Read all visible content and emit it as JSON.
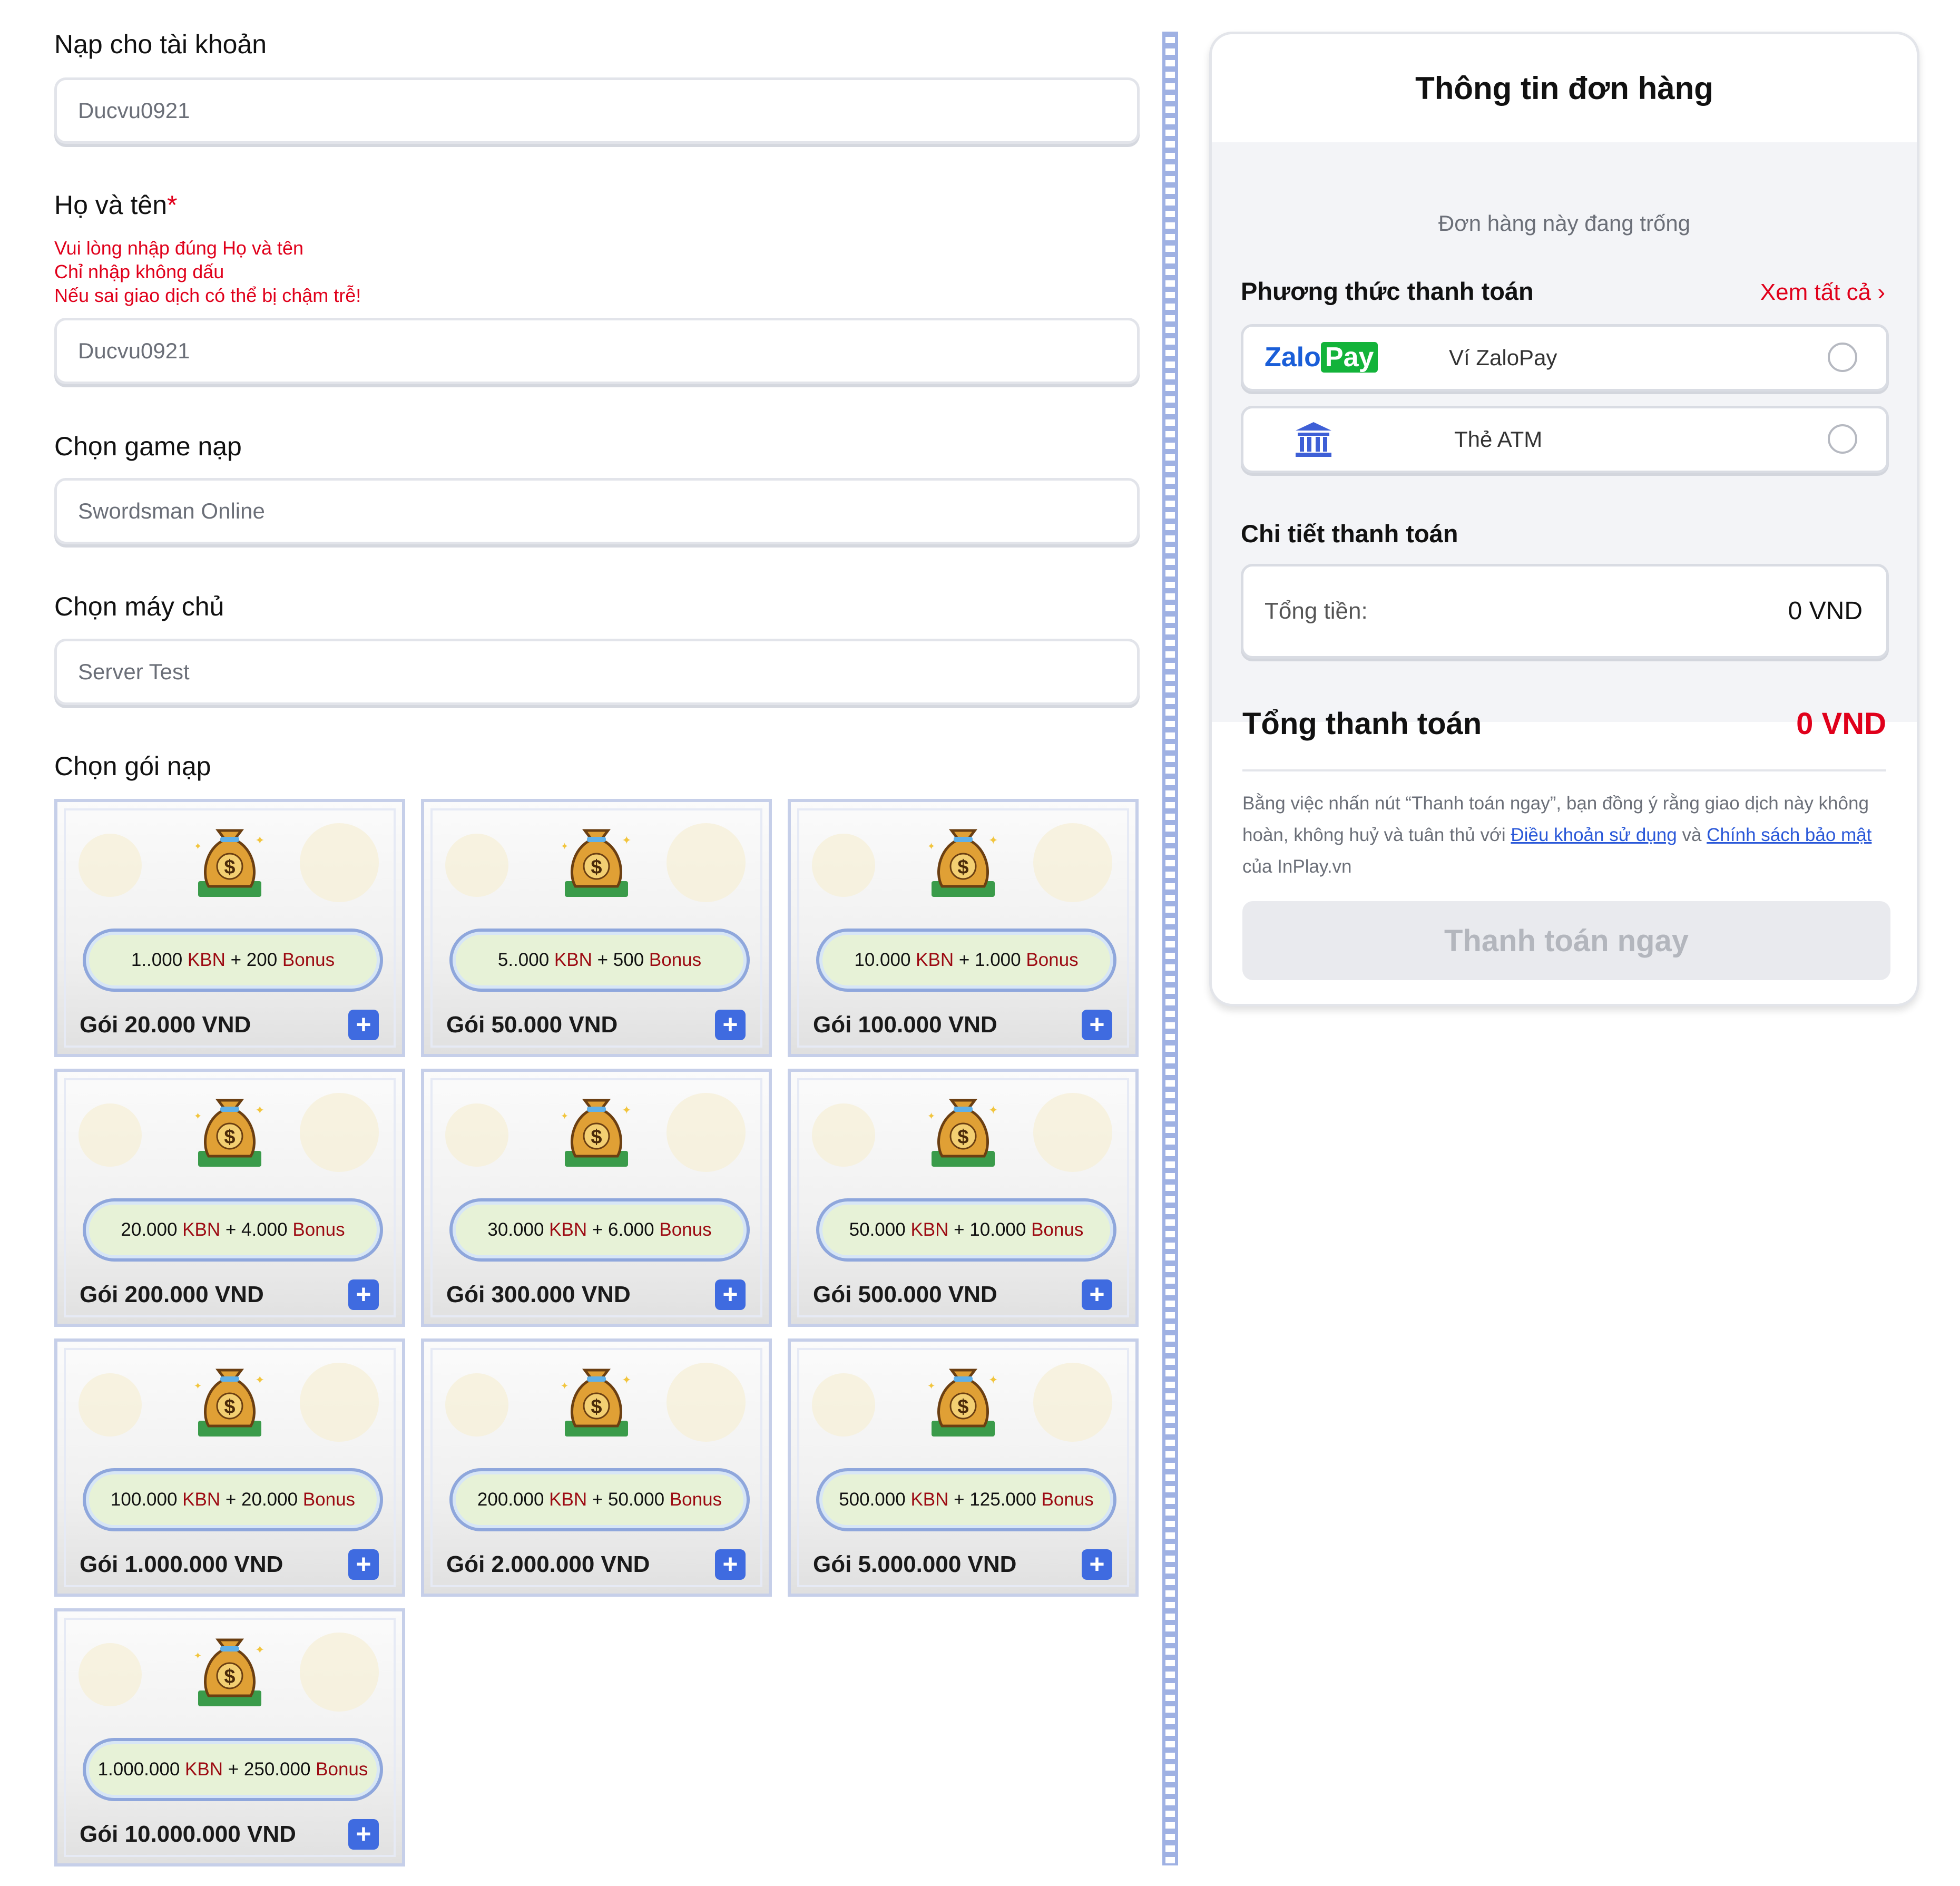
{
  "form": {
    "account_label": "Nạp cho tài khoản",
    "account_value": "Ducvu0921",
    "name_label": "Họ và tên",
    "name_required": "*",
    "name_warnings": [
      "Vui lòng nhập đúng Họ và tên",
      "Chỉ nhập không dấu",
      "Nếu sai giao dịch có thể bị chậm trễ!"
    ],
    "name_value": "Ducvu0921",
    "game_label": "Chọn game nạp",
    "game_value": "Swordsman Online",
    "server_label": "Chọn máy chủ",
    "server_value": "Server Test",
    "package_label": "Chọn gói nạp"
  },
  "packages": [
    {
      "kbn": "1..000",
      "bonus": "200",
      "title": "Gói 20.000 VND"
    },
    {
      "kbn": "5..000",
      "bonus": "500",
      "title": "Gói 50.000 VND"
    },
    {
      "kbn": "10.000",
      "bonus": "1.000",
      "title": "Gói 100.000 VND"
    },
    {
      "kbn": "20.000",
      "bonus": "4.000",
      "title": "Gói 200.000 VND"
    },
    {
      "kbn": "30.000",
      "bonus": "6.000",
      "title": "Gói 300.000 VND"
    },
    {
      "kbn": "50.000",
      "bonus": "10.000",
      "title": "Gói 500.000 VND"
    },
    {
      "kbn": "100.000",
      "bonus": "20.000",
      "title": "Gói 1.000.000 VND"
    },
    {
      "kbn": "200.000",
      "bonus": "50.000",
      "title": "Gói 2.000.000 VND"
    },
    {
      "kbn": "500.000",
      "bonus": "125.000",
      "title": "Gói 5.000.000 VND"
    },
    {
      "kbn": "1.000.000",
      "bonus": "250.000",
      "title": "Gói 10.000.000 VND"
    }
  ],
  "package_text": {
    "kbn_word": "KBN",
    "plus": "+",
    "bonus_word": "Bonus",
    "add_icon": "plus-icon"
  },
  "order": {
    "title": "Thông tin đơn hàng",
    "empty_text": "Đơn hàng này đang trống",
    "payment_method_title": "Phương thức thanh toán",
    "see_all": "Xem tất cả",
    "zalopay_logo_zalo": "Zalo",
    "zalopay_logo_pay": "Pay",
    "zalopay_label": "Ví ZaloPay",
    "atm_label": "Thẻ ATM",
    "details_title": "Chi tiết thanh toán",
    "total_label": "Tổng tiền:",
    "total_value": "0 VND",
    "grand_label": "Tổng thanh toán",
    "grand_value": "0 VND",
    "terms_prefix": "Bằng việc nhấn nút “Thanh toán ngay”, bạn đồng ý rằng giao dịch này không hoàn, không huỷ và tuân thủ với ",
    "terms_link1": "Điều khoản sử dụng",
    "terms_and": " và ",
    "terms_link2": "Chính sách bảo mật",
    "terms_suffix": " của InPlay.vn",
    "pay_button": "Thanh toán ngay"
  },
  "colors": {
    "accent_red": "#e0001b",
    "plus_blue": "#3f6be0",
    "zalo_blue": "#1a5ed8",
    "zalo_green": "#13b33a"
  }
}
